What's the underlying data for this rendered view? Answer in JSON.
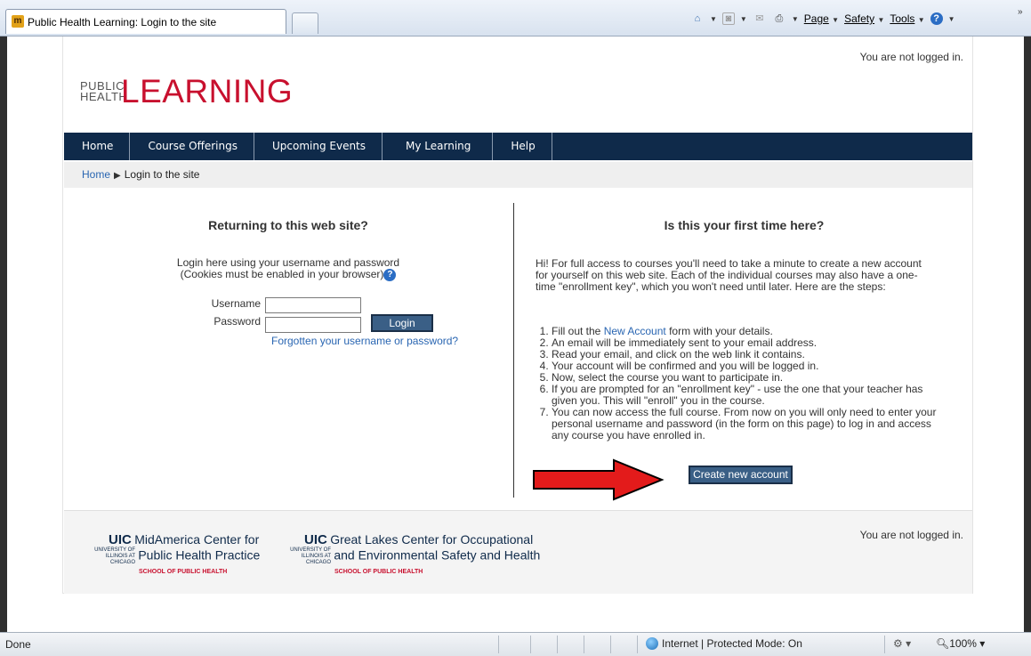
{
  "browser": {
    "tab_title": "Public Health Learning: Login to the site",
    "favicon_text": "m",
    "commands": {
      "page": "Page",
      "safety": "Safety",
      "tools": "Tools"
    },
    "status": {
      "left": "Done",
      "zone": "Internet | Protected Mode: On",
      "zoom": "100%"
    }
  },
  "header": {
    "login_info": "You are not logged in.",
    "logo_small_1": "PUBLIC",
    "logo_small_2": "HEALTH",
    "logo_big": "LEARNING"
  },
  "nav": [
    "Home",
    "Course Offerings",
    "Upcoming Events",
    "My Learning",
    "Help"
  ],
  "breadcrumb": {
    "home": "Home",
    "separator": "▶",
    "current": "Login to the site"
  },
  "login": {
    "heading": "Returning to this web site?",
    "desc1": "Login here using your username and password",
    "desc2": "(Cookies must be enabled in your browser)",
    "username_label": "Username",
    "password_label": "Password",
    "login_button": "Login",
    "forgot_link": "Forgotten your username or password?"
  },
  "signup": {
    "heading": "Is this your first time here?",
    "intro": "Hi! For full access to courses you'll need to take a minute to create a new account for yourself on this web site. Each of the individual courses may also have a one-time \"enrollment key\", which you won't need until later. Here are the steps:",
    "step1_pre": "Fill out the",
    "step1_link": "New Account",
    "step1_post": "form with your details.",
    "steps": [
      "An email will be immediately sent to your email address.",
      "Read your email, and click on the web link it contains.",
      "Your account will be confirmed and you will be logged in.",
      "Now, select the course you want to participate in.",
      "If you are prompted for an \"enrollment key\" - use the one that your teacher has given you. This will \"enroll\" you in the course.",
      "You can now access the full course. From now on you will only need to enter your personal username and password (in the form on this page) to log in and access any course you have enrolled in."
    ],
    "create_button": "Create new account"
  },
  "footer": {
    "login_info": "You are not logged in.",
    "logo1": {
      "uic": "UIC",
      "line1": "MidAmerica Center for",
      "line2": "Public Health Practice",
      "univ": "UNIVERSITY OF ILLINOIS AT CHICAGO",
      "school": "SCHOOL OF PUBLIC HEALTH"
    },
    "logo2": {
      "uic": "UIC",
      "line1": "Great Lakes Center for Occupational",
      "line2": "and Environmental Safety and Health",
      "univ": "UNIVERSITY OF ILLINOIS AT CHICAGO",
      "school": "SCHOOL OF PUBLIC HEALTH"
    }
  },
  "colors": {
    "nav_bg": "#0f2a4a",
    "brand_red": "#c8102e",
    "link": "#2a66b2",
    "button_bg": "#3a5f86",
    "arrow": "#e31b1b"
  }
}
